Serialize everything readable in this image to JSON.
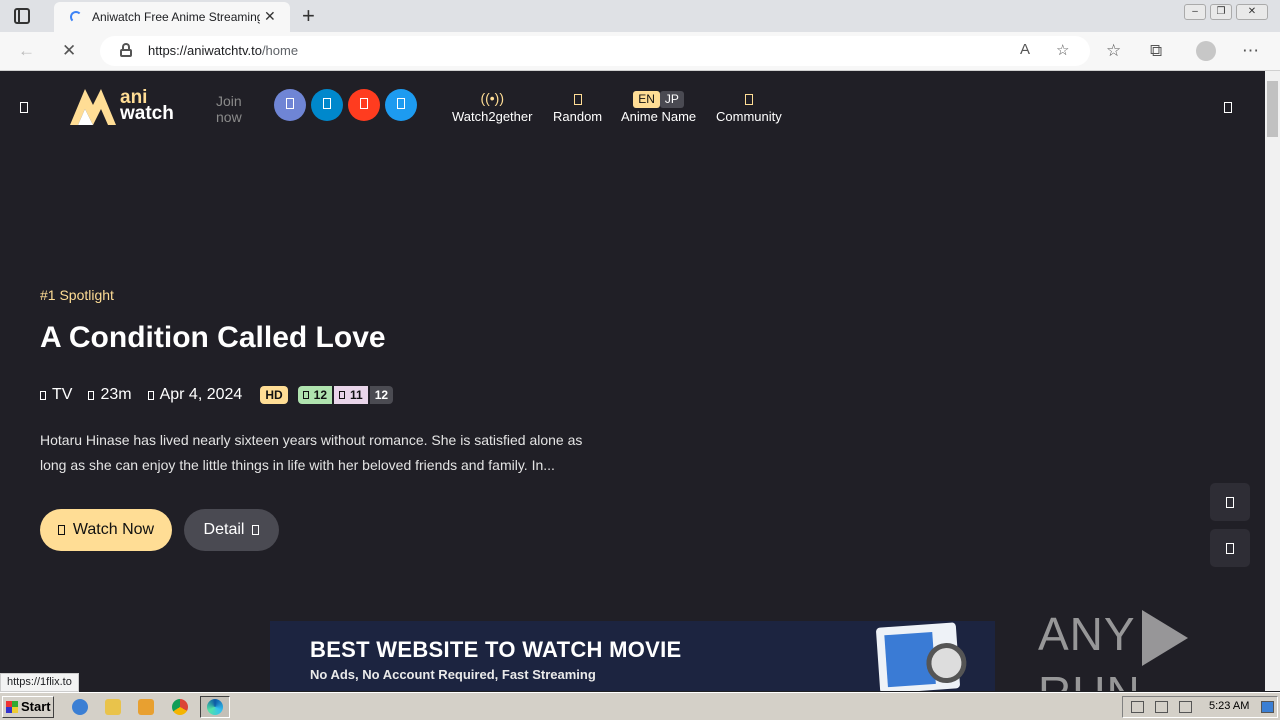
{
  "browser": {
    "tab_title": "Aniwatch Free Anime Streaming Homepage",
    "tab_close": "✕",
    "new_tab": "+",
    "url_host": "https://aniwatchtv.to",
    "url_path": "/home",
    "status_url": "https://1flix.to"
  },
  "site": {
    "logo_line1": "ani",
    "logo_line2": "watch",
    "join_now": "Join now",
    "nav": {
      "watch2gether": "Watch2gether",
      "random": "Random",
      "anime_name": "Anime Name",
      "lang_en": "EN",
      "lang_jp": "JP",
      "community": "Community"
    },
    "colors": {
      "accent": "#ffdd95",
      "background": "#201f26",
      "discord": "#6f85d5",
      "telegram": "#0088cc",
      "reddit": "#ff3c1f",
      "twitter": "#1d9bf0"
    }
  },
  "spotlight": {
    "rank": "#1 Spotlight",
    "title": "A Condition Called Love",
    "type": "TV",
    "duration": "23m",
    "date": "Apr 4, 2024",
    "quality": "HD",
    "sub_count": "12",
    "dub_count": "11",
    "eps_count": "12",
    "description": "Hotaru Hinase has lived nearly sixteen years without romance. She is satisfied alone as long as she can enjoy the little things in life with her beloved friends and family. In...",
    "watch_now": "Watch Now",
    "detail": "Detail"
  },
  "banner": {
    "title": "BEST WEBSITE TO WATCH MOVIE",
    "subtitle": "No Ads, No Account Required, Fast Streaming"
  },
  "watermark": {
    "left": "ANY",
    "right": "RUN"
  },
  "taskbar": {
    "start": "Start",
    "clock": "5:23 AM"
  }
}
